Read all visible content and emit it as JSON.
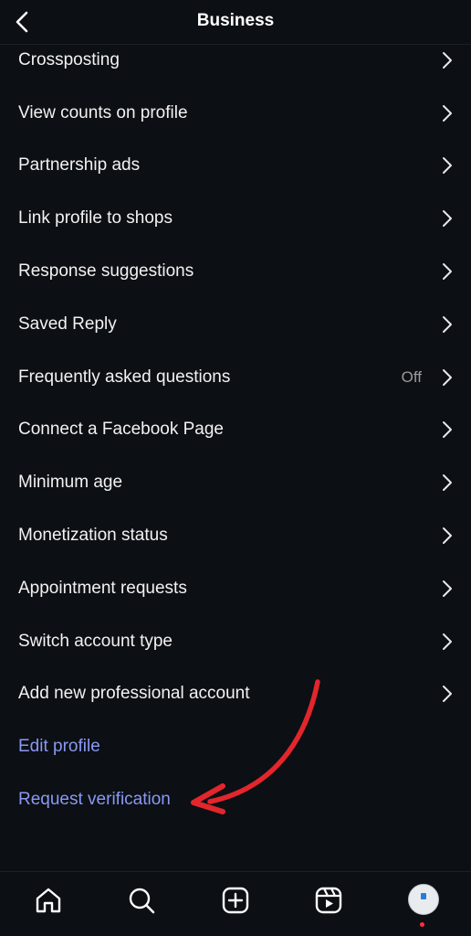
{
  "header": {
    "title": "Business",
    "back_icon": "chevron-left-icon"
  },
  "rows": [
    {
      "label": "Crossposting"
    },
    {
      "label": "View counts on profile"
    },
    {
      "label": "Partnership ads"
    },
    {
      "label": "Link profile to shops"
    },
    {
      "label": "Response suggestions"
    },
    {
      "label": "Saved Reply"
    },
    {
      "label": "Frequently asked questions",
      "value": "Off"
    },
    {
      "label": "Connect a Facebook Page"
    },
    {
      "label": "Minimum age"
    },
    {
      "label": "Monetization status"
    },
    {
      "label": "Appointment requests"
    },
    {
      "label": "Switch account type"
    },
    {
      "label": "Add new professional account"
    }
  ],
  "links": [
    {
      "label": "Edit profile"
    },
    {
      "label": "Request verification"
    }
  ],
  "nav": [
    "home-icon",
    "search-icon",
    "create-icon",
    "reels-icon",
    "profile-avatar"
  ],
  "colors": {
    "background": "#0c0f14",
    "link": "#8a99f2",
    "annotation_arrow": "#e3262c",
    "notification_dot": "#ff3040"
  }
}
